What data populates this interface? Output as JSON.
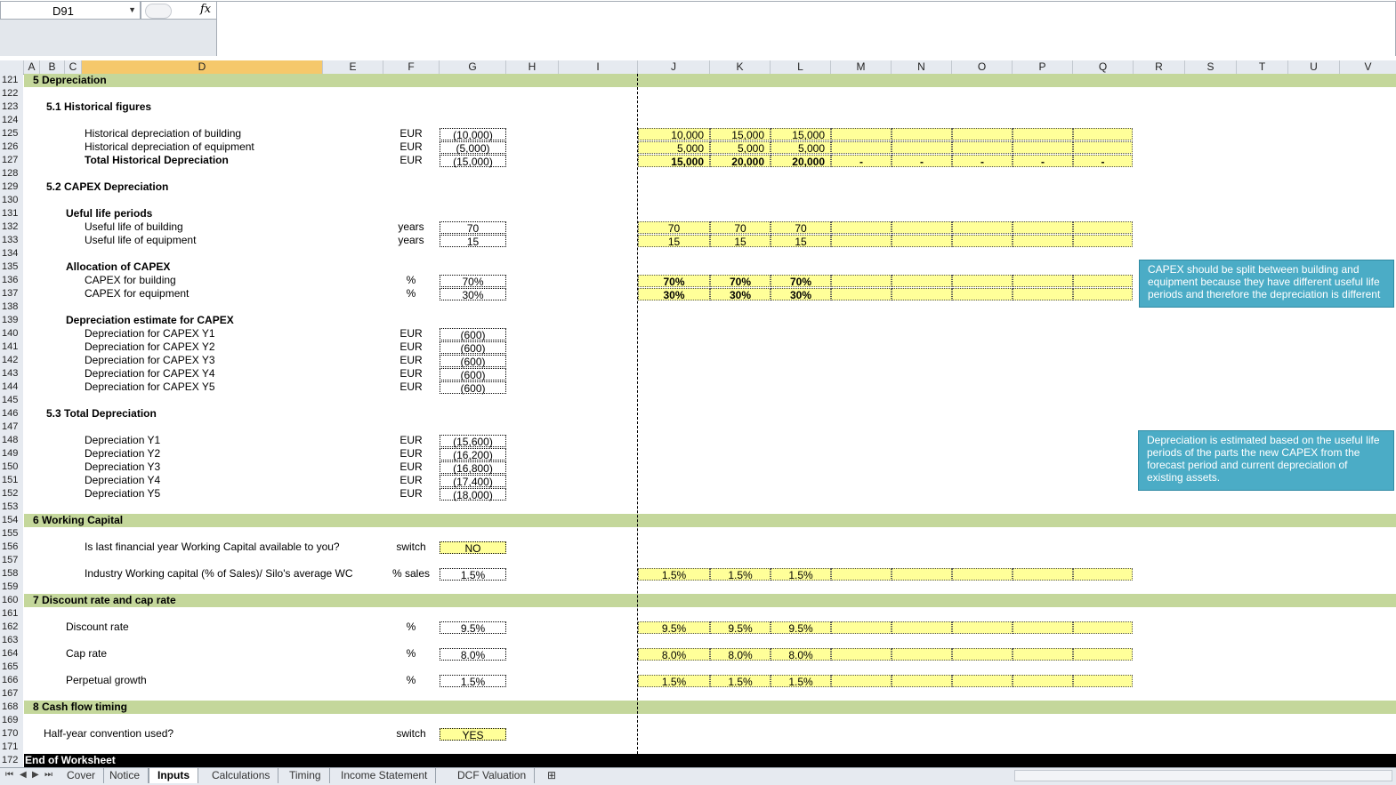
{
  "name_box": "D91",
  "fx_label": "fx",
  "columns": [
    "A",
    "B",
    "C",
    "D",
    "E",
    "F",
    "G",
    "H",
    "I",
    "J",
    "K",
    "L",
    "M",
    "N",
    "O",
    "P",
    "Q",
    "R",
    "S",
    "T",
    "U",
    "V"
  ],
  "rows": [
    "121",
    "122",
    "123",
    "124",
    "125",
    "126",
    "127",
    "128",
    "129",
    "130",
    "131",
    "132",
    "133",
    "134",
    "135",
    "136",
    "137",
    "138",
    "139",
    "140",
    "141",
    "142",
    "143",
    "144",
    "145",
    "146",
    "147",
    "148",
    "149",
    "150",
    "151",
    "152",
    "153",
    "154",
    "155",
    "156",
    "157",
    "158",
    "159",
    "160",
    "161",
    "162",
    "163",
    "164",
    "165",
    "166",
    "167",
    "168",
    "169",
    "170",
    "171",
    "172"
  ],
  "sections": {
    "s5": "5  Depreciation",
    "s6": "6  Working Capital",
    "s7": "7  Discount rate and cap rate",
    "s8": "8  Cash flow timing"
  },
  "sub": {
    "s51": "5.1  Historical figures",
    "s52": "5.2  CAPEX Depreciation",
    "s53": "5.3  Total Depreciation",
    "useful": "Ueful life periods",
    "alloc": "Allocation of CAPEX",
    "dep_est": "Depreciation estimate for CAPEX"
  },
  "lines": {
    "hist_building": {
      "label": "Historical depreciation of building",
      "unit": "EUR",
      "value": "(10,000)",
      "j": "10,000",
      "k": "15,000",
      "l": "15,000"
    },
    "hist_equip": {
      "label": "Historical depreciation of equipment",
      "unit": "EUR",
      "value": "(5,000)",
      "j": "5,000",
      "k": "5,000",
      "l": "5,000"
    },
    "hist_total": {
      "label": "Total Historical Depreciation",
      "unit": "EUR",
      "value": "(15,000)",
      "j": "15,000",
      "k": "20,000",
      "l": "20,000",
      "dash": "-"
    },
    "life_building": {
      "label": "Useful life of building",
      "unit": "years",
      "value": "70",
      "j": "70",
      "k": "70",
      "l": "70"
    },
    "life_equip": {
      "label": "Useful life of equipment",
      "unit": "years",
      "value": "15",
      "j": "15",
      "k": "15",
      "l": "15"
    },
    "capex_building": {
      "label": "CAPEX for building",
      "unit": "%",
      "value": "70%",
      "j": "70%",
      "k": "70%",
      "l": "70%"
    },
    "capex_equip": {
      "label": "CAPEX for equipment",
      "unit": "%",
      "value": "30%",
      "j": "30%",
      "k": "30%",
      "l": "30%"
    },
    "dep_y1": {
      "label": "Depreciation for CAPEX Y1",
      "unit": "EUR",
      "value": "(600)"
    },
    "dep_y2": {
      "label": "Depreciation for CAPEX Y2",
      "unit": "EUR",
      "value": "(600)"
    },
    "dep_y3": {
      "label": "Depreciation for CAPEX Y3",
      "unit": "EUR",
      "value": "(600)"
    },
    "dep_y4": {
      "label": "Depreciation for CAPEX Y4",
      "unit": "EUR",
      "value": "(600)"
    },
    "dep_y5": {
      "label": "Depreciation for CAPEX Y5",
      "unit": "EUR",
      "value": "(600)"
    },
    "tot_y1": {
      "label": "Depreciation Y1",
      "unit": "EUR",
      "value": "(15,600)"
    },
    "tot_y2": {
      "label": "Depreciation Y2",
      "unit": "EUR",
      "value": "(16,200)"
    },
    "tot_y3": {
      "label": "Depreciation Y3",
      "unit": "EUR",
      "value": "(16,800)"
    },
    "tot_y4": {
      "label": "Depreciation Y4",
      "unit": "EUR",
      "value": "(17,400)"
    },
    "tot_y5": {
      "label": "Depreciation Y5",
      "unit": "EUR",
      "value": "(18,000)"
    },
    "wc_switch": {
      "label": "Is last financial year Working Capital available to you?",
      "unit": "switch",
      "value": "NO"
    },
    "wc_pct": {
      "label": "Industry Working capital (% of Sales)/ Silo's average WC",
      "unit": "% sales",
      "value": "1.5%",
      "j": "1.5%",
      "k": "1.5%",
      "l": "1.5%"
    },
    "discount": {
      "label": "Discount rate",
      "unit": "%",
      "value": "9.5%",
      "j": "9.5%",
      "k": "9.5%",
      "l": "9.5%"
    },
    "cap": {
      "label": "Cap rate",
      "unit": "%",
      "value": "8.0%",
      "j": "8.0%",
      "k": "8.0%",
      "l": "8.0%"
    },
    "growth": {
      "label": "Perpetual growth",
      "unit": "%",
      "value": "1.5%",
      "j": "1.5%",
      "k": "1.5%",
      "l": "1.5%"
    },
    "halfyear": {
      "label": "Half-year convention used?",
      "unit": "switch",
      "value": "YES"
    }
  },
  "notes": {
    "capex": "CAPEX  should be split between building and equipment  because they have different useful life periods and therefore the depreciation is different",
    "dep": "Depreciation is estimated based on the useful life periods of the parts the new CAPEX  from the forecast period and current depreciation of existing assets."
  },
  "end_text": "End of Worksheet",
  "tabs": [
    "Cover",
    "Notice",
    "Inputs",
    "Calculations",
    "Timing",
    "Income Statement",
    "DCF Valuation"
  ],
  "active_tab": "Inputs",
  "colors": {
    "section_band": "#c4d79b",
    "input_yellow": "#ffff99",
    "note_blue": "#4bacc6",
    "selected_col": "#f5c86b"
  }
}
